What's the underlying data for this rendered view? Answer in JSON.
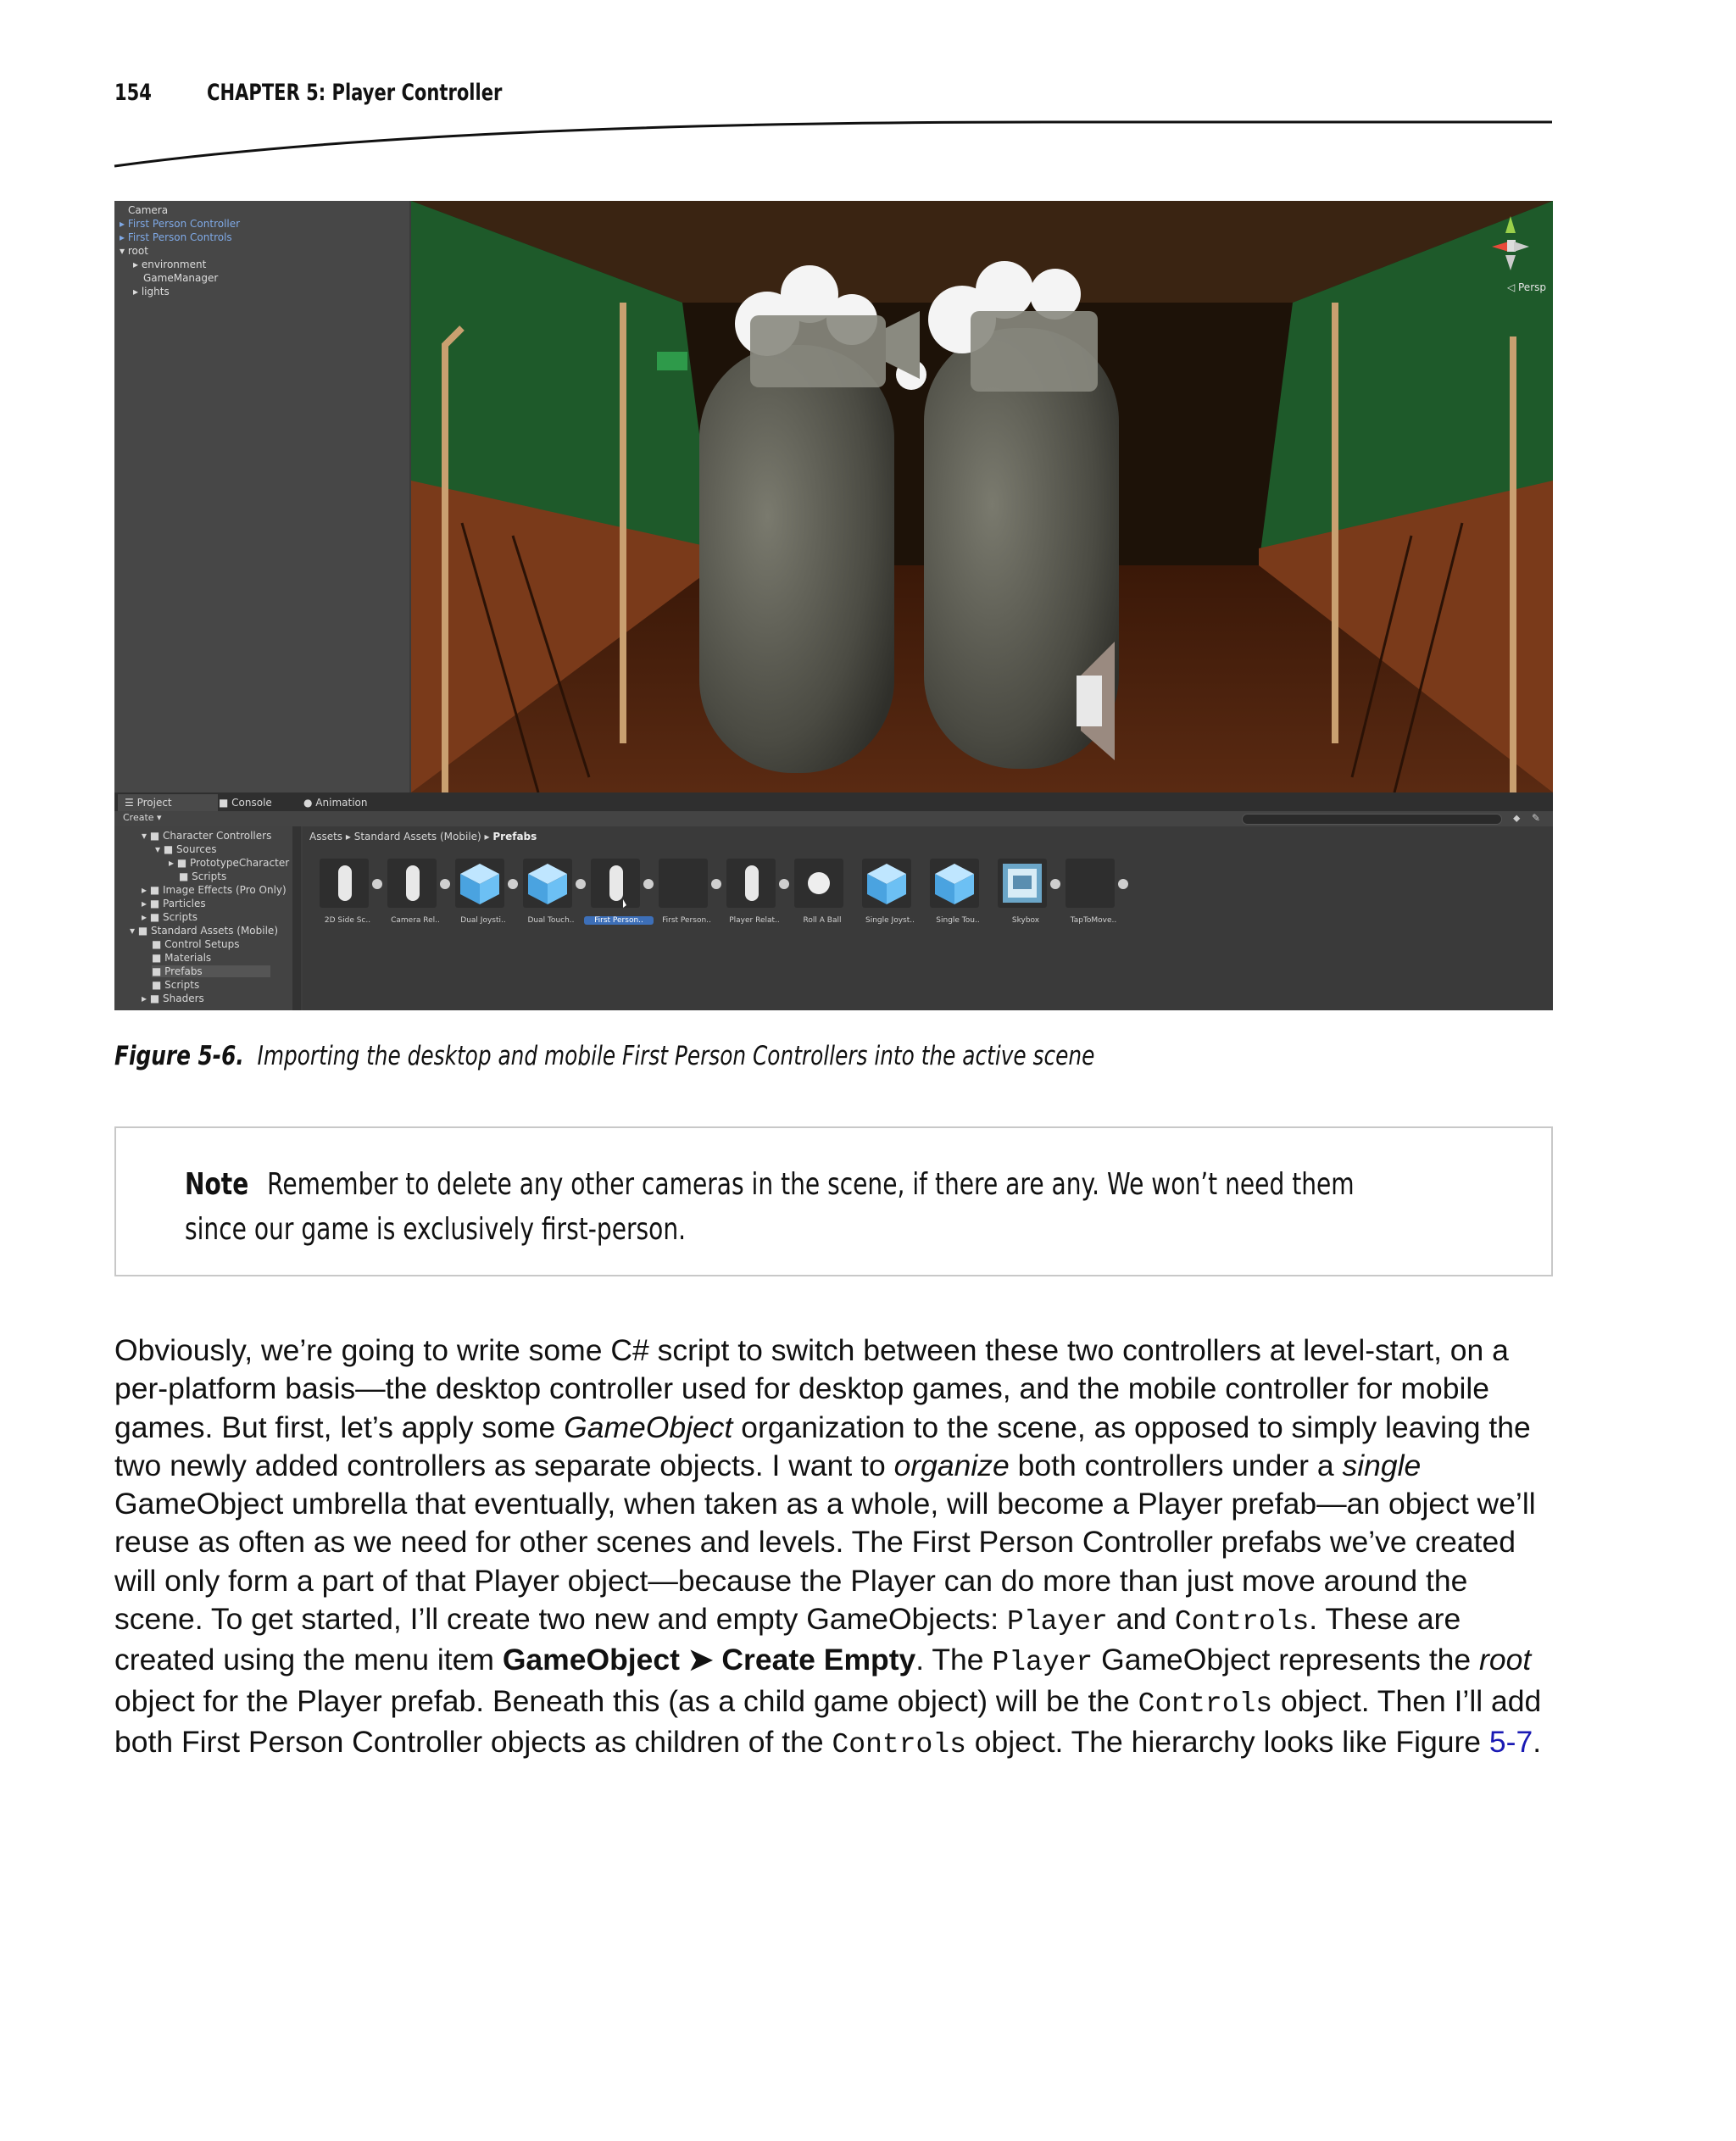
{
  "header": {
    "page_number": "154",
    "chapter_title": "CHAPTER 5: Player Controller"
  },
  "figure": {
    "hierarchy_items": [
      "Camera",
      "First Person Controller",
      "First Person Controls",
      "root",
      "environment",
      "GameManager",
      "lights"
    ],
    "scene_view_label": "Persp",
    "tabs": [
      "Project",
      "Console",
      "Animation"
    ],
    "create_label": "Create",
    "project_tree": [
      "Character Controllers",
      "Sources",
      "PrototypeCharacter",
      "Scripts",
      "Image Effects (Pro Only)",
      "Particles",
      "Scripts",
      "Standard Assets (Mobile)",
      "Control Setups",
      "Materials",
      "Prefabs",
      "Scripts",
      "Shaders"
    ],
    "breadcrumb": [
      "Assets",
      "Standard Assets (Mobile)",
      "Prefabs"
    ],
    "assets": [
      "2D Side Sc..",
      "Camera Rel..",
      "Dual Joysti..",
      "Dual Touch..",
      "First Person..",
      "First Person..",
      "Player Relat..",
      "Roll A Ball",
      "Single Joyst..",
      "Single Tou..",
      "Skybox",
      "TapToMove.."
    ]
  },
  "caption": {
    "label": "Figure 5-6.",
    "text": "Importing the desktop and mobile First Person Controllers into the active scene"
  },
  "note": {
    "label": "Note",
    "text": "Remember to delete any other cameras in the scene, if there are any. We won’t need them since our game is exclusively first-person."
  },
  "body": {
    "s1": "Obviously, we’re going to write some C# script to switch between these two controllers at level-start, on a per-platform basis—the desktop controller used for desktop games, and the mobile controller for mobile games. But first, let’s apply some ",
    "em1": "GameObject",
    "s2": " organization to the scene, as opposed to simply leaving the two newly added controllers as separate objects. I want to ",
    "em2": "organize",
    "s3": " both controllers under a ",
    "em3": "single",
    "s4": " GameObject umbrella that eventually, when taken as a whole, will become a Player prefab—an object we’ll reuse as often as we need for other scenes and levels. The First Person Controller prefabs we’ve created will only form a part of that Player object—because the Player can do more than just move around the scene. To get started, I’ll create two new and empty GameObjects: ",
    "code1": "Player",
    "s5": " and ",
    "code2": "Controls",
    "s6": ". These are created using the menu item ",
    "bold1": "GameObject ➤ Create Empty",
    "s7": ". The ",
    "code3": "Player",
    "s8": " GameObject represents the ",
    "em4": "root",
    "s9": " object for the Player prefab. Beneath this (as a child game object) will be the ",
    "code4": "Controls",
    "s10": " object. Then I’ll add both First Person Controller objects as children of the ",
    "code5": "Controls",
    "s11": " object. The hierarchy looks like Figure ",
    "link": "5-7",
    "s12": "."
  }
}
